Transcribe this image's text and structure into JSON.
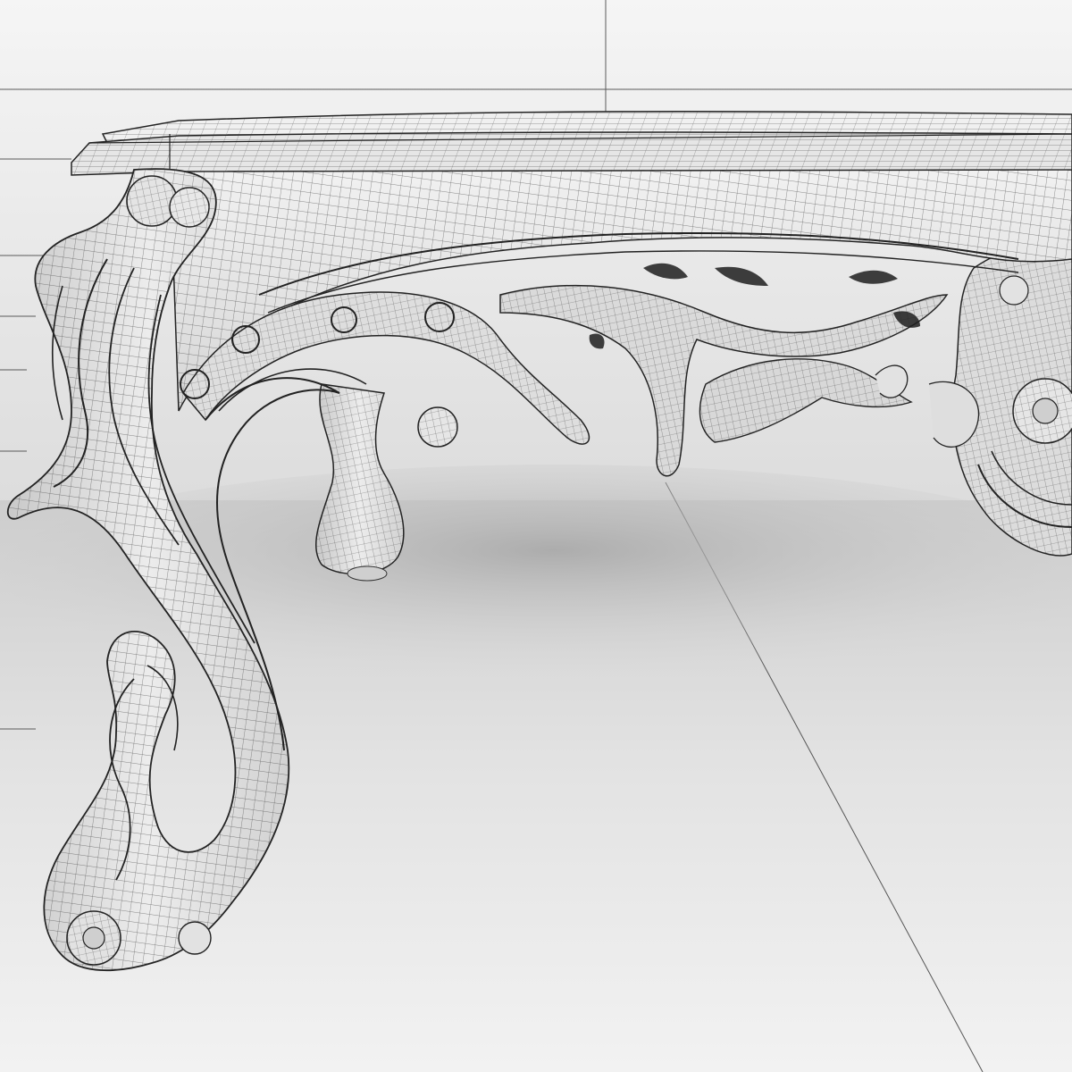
{
  "scene": {
    "subject": "wireframe-render-carved-baroque-console-table",
    "colors": {
      "wall_top": "#f4f4f4",
      "wall_bottom": "#d9d9d9",
      "floor_far": "#cfcfcf",
      "floor_near": "#f3f3f3",
      "surface": "#e9e9e9",
      "surface_shadow": "#bdbdbd",
      "wire": "#3a3a3a",
      "guide_line": "#555555"
    }
  }
}
